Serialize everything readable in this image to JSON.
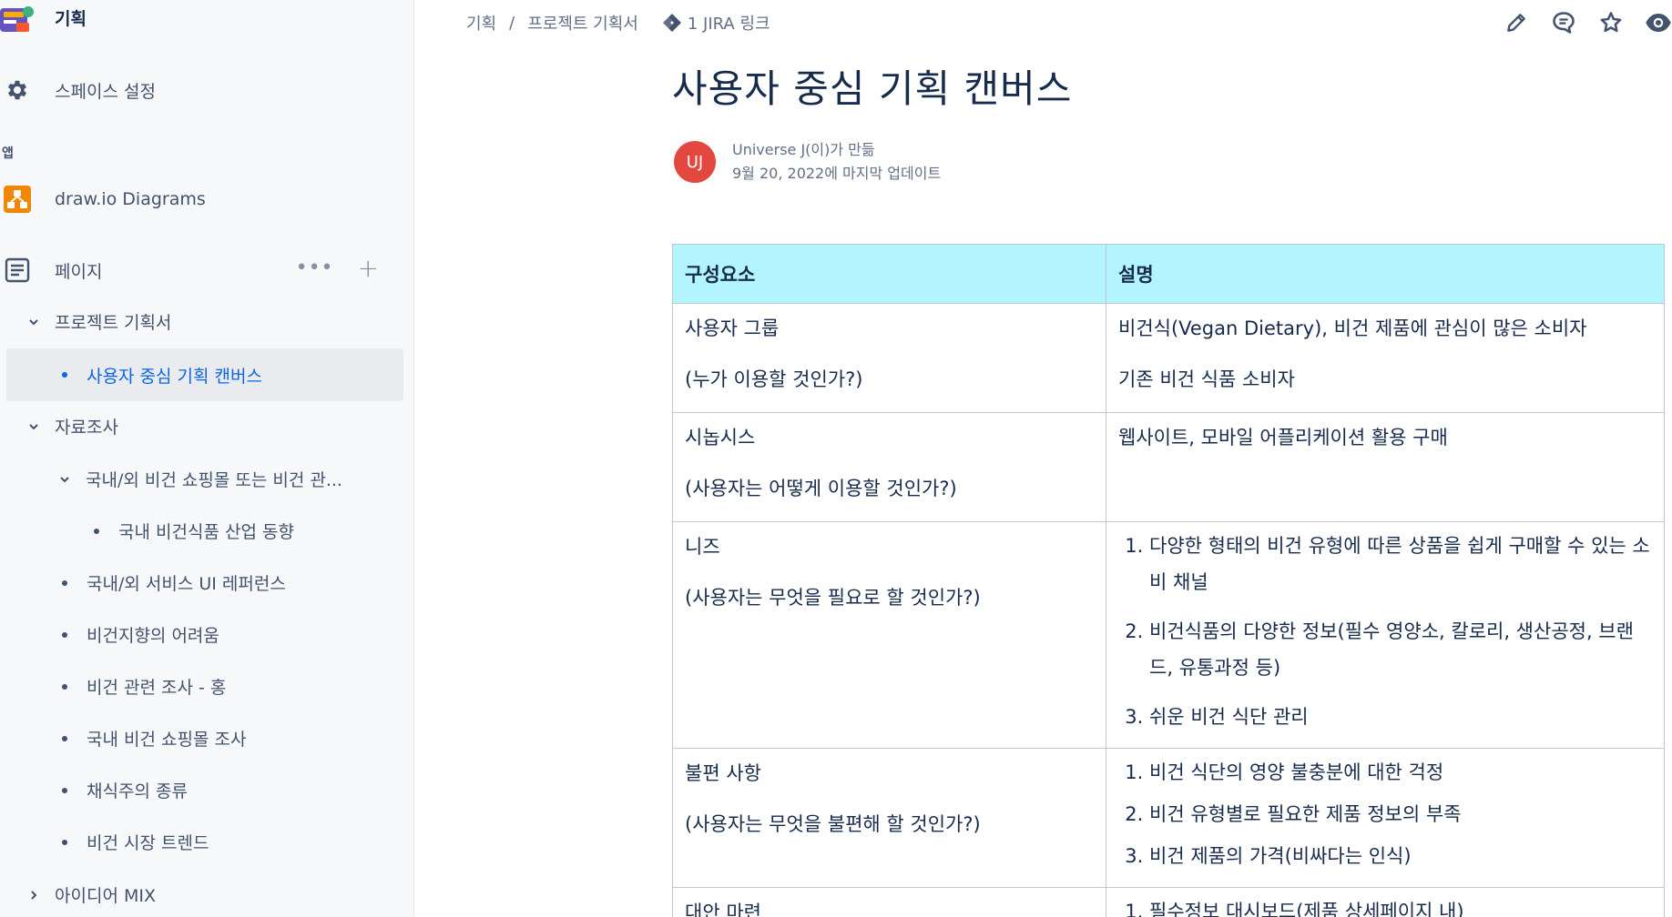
{
  "space": {
    "name": "기획"
  },
  "sidebar": {
    "settings_label": "스페이스 설정",
    "apps_heading": "앱",
    "drawio_label": "draw.io Diagrams",
    "pages_label": "페이지",
    "pages_more": "•••",
    "pages_add": "+",
    "tree": {
      "project_plan": "프로젝트 기획서",
      "current_page": "사용자 중심 기획 캔버스",
      "research": "자료조사",
      "shopping_mall": "국내/외 비건 쇼핑몰 또는 비건 관...",
      "industry_trend": "국내 비건식품 산업 동향",
      "ui_reference": "국내/외 서비스 UI 레퍼런스",
      "vegan_difficulty": "비건지향의 어려움",
      "vegan_survey": "비건 관련 조사 - 홍",
      "domestic_mall": "국내 비건 쇼핑몰 조사",
      "vegetarian_types": "채식주의 종류",
      "market_trend": "비건 시장 트렌드",
      "idea_mix": "아이디어 MIX"
    }
  },
  "breadcrumb": {
    "space": "기획",
    "separator": "/",
    "parent": "프로젝트 기획서",
    "jira": "1 JIRA 링크"
  },
  "page": {
    "title": "사용자 중심 기획 캔버스",
    "author": "Universe J(이)가 만듦",
    "updated": "9월 20, 2022에 마지막 업데이트",
    "avatar_initials": "UJ"
  },
  "table": {
    "headers": [
      "구성요소",
      "설명"
    ],
    "rows": [
      {
        "component": "사용자 그룹",
        "question": "(누가 이용할 것인가?)",
        "desc": [
          "비건식(Vegan Dietary), 비건 제품에 관심이 많은 소비자",
          "기존 비건 식품 소비자"
        ]
      },
      {
        "component": "시놉시스",
        "question": "(사용자는 어떻게 이용할 것인가?)",
        "desc": [
          "웹사이트, 모바일 어플리케이션 활용 구매"
        ]
      },
      {
        "component": "니즈",
        "question": "(사용자는 무엇을 필요로 할 것인가?)",
        "list": [
          "다양한 형태의 비건 유형에 따른 상품을 쉽게 구매할 수 있는 소비 채널",
          "비건식품의 다양한 정보(필수 영양소, 칼로리, 생산공정, 브랜드, 유통과정 등)",
          "쉬운 비건 식단 관리"
        ]
      },
      {
        "component": "불편 사항",
        "question": "(사용자는 무엇을 불편해 할 것인가?)",
        "list": [
          "비건 식단의 영양 불충분에 대한 걱정",
          "비건 유형별로 필요한 제품 정보의 부족",
          "비건 제품의 가격(비싸다는 인식)"
        ]
      },
      {
        "component": "대안 마련",
        "question": "",
        "list": [
          "필수정보 대시보드(제품 상세페이지 내)"
        ]
      }
    ]
  },
  "colors": {
    "header_bg": "#b3f5ff",
    "link_blue": "#0c66e4",
    "avatar_red": "#e2483d",
    "sidebar_bg": "#f7f8f9"
  }
}
